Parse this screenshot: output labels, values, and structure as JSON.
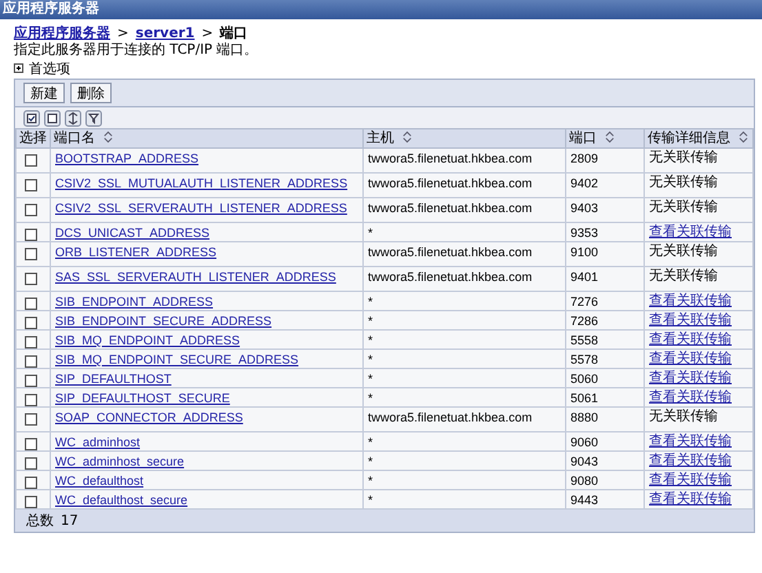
{
  "window": {
    "title": "应用程序服务器"
  },
  "breadcrumb": {
    "links": [
      "应用程序服务器",
      "server1"
    ],
    "separator": ">",
    "current": "端口"
  },
  "description": "指定此服务器用于连接的 TCP/IP 端口。",
  "preferences": {
    "label": "首选项",
    "expanded": false
  },
  "buttons": [
    "新建",
    "删除"
  ],
  "table": {
    "columns": [
      "选择",
      "端口名",
      "主机",
      "端口",
      "传输详细信息"
    ],
    "rows": [
      {
        "checked": false,
        "name": "BOOTSTRAP_ADDRESS",
        "host": "twwora5.filenetuat.hkbea.com",
        "port": "2809",
        "transport": "无关联传输",
        "transport_link": false
      },
      {
        "checked": false,
        "name": "CSIV2_SSL_MUTUALAUTH_LISTENER_ADDRESS",
        "host": "twwora5.filenetuat.hkbea.com",
        "port": "9402",
        "transport": "无关联传输",
        "transport_link": false
      },
      {
        "checked": false,
        "name": "CSIV2_SSL_SERVERAUTH_LISTENER_ADDRESS",
        "host": "twwora5.filenetuat.hkbea.com",
        "port": "9403",
        "transport": "无关联传输",
        "transport_link": false
      },
      {
        "checked": false,
        "name": "DCS_UNICAST_ADDRESS",
        "host": "*",
        "port": "9353",
        "transport": "查看关联传输",
        "transport_link": true
      },
      {
        "checked": false,
        "name": "ORB_LISTENER_ADDRESS",
        "host": "twwora5.filenetuat.hkbea.com",
        "port": "9100",
        "transport": "无关联传输",
        "transport_link": false
      },
      {
        "checked": false,
        "name": "SAS_SSL_SERVERAUTH_LISTENER_ADDRESS",
        "host": "twwora5.filenetuat.hkbea.com",
        "port": "9401",
        "transport": "无关联传输",
        "transport_link": false
      },
      {
        "checked": false,
        "name": "SIB_ENDPOINT_ADDRESS",
        "host": "*",
        "port": "7276",
        "transport": "查看关联传输",
        "transport_link": true
      },
      {
        "checked": false,
        "name": "SIB_ENDPOINT_SECURE_ADDRESS",
        "host": "*",
        "port": "7286",
        "transport": "查看关联传输",
        "transport_link": true
      },
      {
        "checked": false,
        "name": "SIB_MQ_ENDPOINT_ADDRESS",
        "host": "*",
        "port": "5558",
        "transport": "查看关联传输",
        "transport_link": true
      },
      {
        "checked": false,
        "name": "SIB_MQ_ENDPOINT_SECURE_ADDRESS",
        "host": "*",
        "port": "5578",
        "transport": "查看关联传输",
        "transport_link": true
      },
      {
        "checked": false,
        "name": "SIP_DEFAULTHOST",
        "host": "*",
        "port": "5060",
        "transport": "查看关联传输",
        "transport_link": true
      },
      {
        "checked": false,
        "name": "SIP_DEFAULTHOST_SECURE",
        "host": "*",
        "port": "5061",
        "transport": "查看关联传输",
        "transport_link": true
      },
      {
        "checked": false,
        "name": "SOAP_CONNECTOR_ADDRESS",
        "host": "twwora5.filenetuat.hkbea.com",
        "port": "8880",
        "transport": "无关联传输",
        "transport_link": false
      },
      {
        "checked": false,
        "name": "WC_adminhost",
        "host": "*",
        "port": "9060",
        "transport": "查看关联传输",
        "transport_link": true
      },
      {
        "checked": false,
        "name": "WC_adminhost_secure",
        "host": "*",
        "port": "9043",
        "transport": "查看关联传输",
        "transport_link": true
      },
      {
        "checked": false,
        "name": "WC_defaulthost",
        "host": "*",
        "port": "9080",
        "transport": "查看关联传输",
        "transport_link": true
      },
      {
        "checked": false,
        "name": "WC_defaulthost_secure",
        "host": "*",
        "port": "9443",
        "transport": "查看关联传输",
        "transport_link": true
      }
    ]
  },
  "total": {
    "label": "总数",
    "value": "17"
  }
}
